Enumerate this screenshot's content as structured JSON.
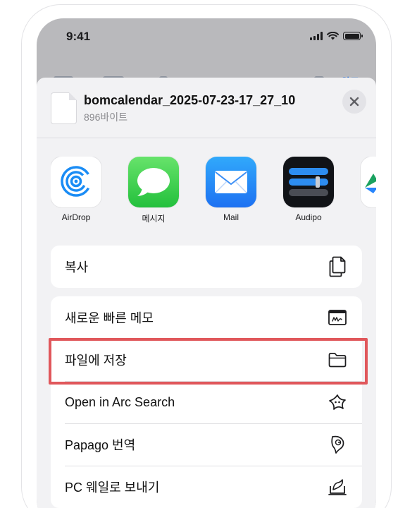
{
  "status_bar": {
    "time": "9:41"
  },
  "behind": {
    "right_text": "완료"
  },
  "share_sheet": {
    "file_name": "bomcalendar_2025-07-23-17_27_10",
    "file_size": "896바이트",
    "close_icon": "close-icon"
  },
  "apps": [
    {
      "label": "AirDrop",
      "icon": "airdrop-icon"
    },
    {
      "label": "메시지",
      "icon": "messages-icon"
    },
    {
      "label": "Mail",
      "icon": "mail-icon"
    },
    {
      "label": "Audipo",
      "icon": "audipo-icon"
    }
  ],
  "actions_group1": [
    {
      "label": "복사",
      "icon": "copy-icon"
    }
  ],
  "actions_group2": [
    {
      "label": "새로운 빠른 메모",
      "icon": "quick-note-icon"
    },
    {
      "label": "파일에 저장",
      "icon": "folder-icon"
    },
    {
      "label": "Open in Arc Search",
      "icon": "arc-search-icon"
    },
    {
      "label": "Papago 번역",
      "icon": "papago-icon"
    },
    {
      "label": "PC 웨일로 보내기",
      "icon": "whale-send-icon"
    }
  ],
  "colors": {
    "highlight": "#e0575b",
    "sheet_bg": "#f2f2f4",
    "dim_bg": "#b9b9bc"
  }
}
